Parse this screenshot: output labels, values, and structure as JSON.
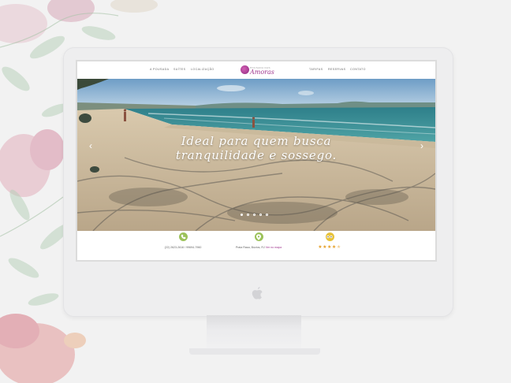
{
  "nav": {
    "left_links": [
      "A POUSADA",
      "SUÍTES",
      "LOCALIZAÇÃO"
    ],
    "right_links": [
      "TARIFAS",
      "RESERVAS",
      "CONTATO"
    ],
    "logo": {
      "prefix": "POUSADA DAS",
      "name": "Amoras"
    }
  },
  "hero": {
    "headline_line1": "Ideal para quem busca",
    "headline_line2": "tranquilidade e sossego.",
    "prev_arrow": "‹",
    "next_arrow": "›",
    "slides": 5,
    "active_slide": 1
  },
  "footer": {
    "phone_text": "(22) 2623-2616 / 99694-7960",
    "location_text": "Praia Rasa, Búzios, RJ",
    "location_link": "Ver no mapa",
    "rating_stars": "★★★★",
    "rating_half": "★",
    "rating_value": 4.5
  },
  "colors": {
    "accent": "#a0368e",
    "phone_icon_bg": "#9cc25a",
    "location_icon_bg": "#9cc25a",
    "tripadvisor_icon_bg": "#e7c23b",
    "star": "#e6a12a"
  },
  "icons": {
    "phone": "phone-icon",
    "location": "map-pin-icon",
    "rating": "tripadvisor-icon"
  }
}
